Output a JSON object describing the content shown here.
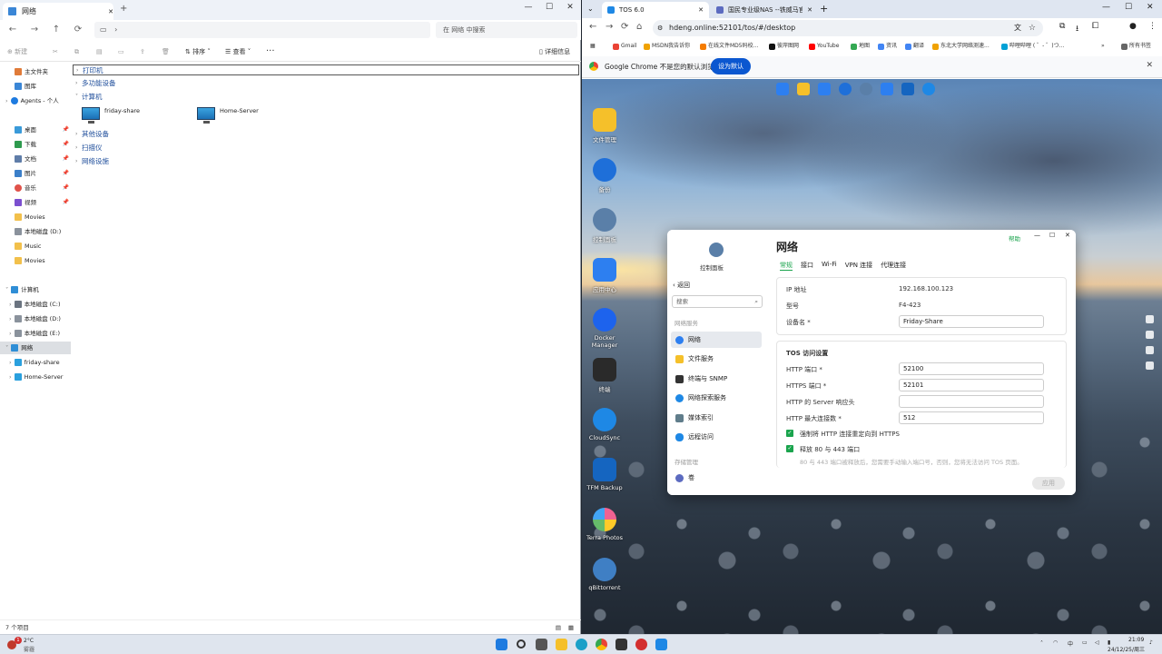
{
  "explorer": {
    "tab_title": "网络",
    "new_tab": "+",
    "window_controls": {
      "minimize": "—",
      "maximize": "☐",
      "close": "✕"
    },
    "address": "›",
    "search_placeholder": "在 网络 中搜索",
    "commands": {
      "new": "新建",
      "sort": "排序",
      "view": "查看",
      "more": "···",
      "details": "详细信息"
    },
    "nav": [
      {
        "label": "主文件夹"
      },
      {
        "label": "图库"
      },
      {
        "label": "Agents - 个人"
      },
      {
        "label": "桌面"
      },
      {
        "label": "下载"
      },
      {
        "label": "文档"
      },
      {
        "label": "图片"
      },
      {
        "label": "音乐"
      },
      {
        "label": "视频"
      },
      {
        "label": "Movies"
      },
      {
        "label": "本地磁盘 (D:)"
      },
      {
        "label": "Music"
      },
      {
        "label": "Movies"
      },
      {
        "label": "计算机"
      },
      {
        "label": "本地磁盘 (C:)"
      },
      {
        "label": "本地磁盘 (D:)"
      },
      {
        "label": "本地磁盘 (E:)"
      },
      {
        "label": "网络"
      },
      {
        "label": "friday-share"
      },
      {
        "label": "Home-Server"
      }
    ],
    "groups": {
      "printers": "打印机",
      "multifunction": "多功能设备",
      "computers": "计算机",
      "other": "其他设备",
      "scanners": "扫描仪",
      "infrastructure": "网络设施"
    },
    "computers": [
      {
        "name": "friday-share"
      },
      {
        "name": "Home-Server"
      }
    ],
    "status": "7 个项目"
  },
  "chrome": {
    "tabs": [
      {
        "title": "TOS 6.0",
        "close": "✕"
      },
      {
        "title": "国民专业级NAS --铁威马官方...",
        "close": "✕"
      }
    ],
    "new_tab": "+",
    "url": "hdeng.online:52101/tos/#/desktop",
    "bookmarks": [
      "Gmail",
      "MSDN我告诉你",
      "在线文件MD5码校...",
      "彼岸图网",
      "YouTube",
      "地图",
      "资讯",
      "翻译",
      "东北大学网络测速...",
      "哔哩哔哩 ( ゜- ゜)つ..."
    ],
    "all_bookmarks": "所有书签",
    "infobar": {
      "message": "Google Chrome 不是您的默认浏览器",
      "button": "设为默认"
    }
  },
  "desktop_icons": [
    {
      "label": "文件管理",
      "color": "#f5c02a"
    },
    {
      "label": "备份",
      "color": "#1e6fd9"
    },
    {
      "label": "控制面板",
      "color": "#5a7fa8"
    },
    {
      "label": "应用中心",
      "color": "#2d7ff0"
    },
    {
      "label": "Docker Manager",
      "color": "#1d63ed"
    },
    {
      "label": "终端",
      "color": "#2a2a2a"
    },
    {
      "label": "CloudSync",
      "color": "#1e88e5"
    },
    {
      "label": "TFM Backup",
      "color": "#1565c0"
    },
    {
      "label": "Terra Photos",
      "color": "#f06292"
    },
    {
      "label": "qBittorrent",
      "color": "#3f7fc4"
    }
  ],
  "control_panel": {
    "app_title": "控制面板",
    "help": "帮助",
    "back": "返回",
    "search_placeholder": "搜索",
    "section_network": "网络服务",
    "section_storage": "存储管理",
    "side": [
      {
        "label": "网络",
        "color": "#2d7ff0"
      },
      {
        "label": "文件服务",
        "color": "#f5c02a"
      },
      {
        "label": "终端与 SNMP",
        "color": "#333"
      },
      {
        "label": "网络探索服务",
        "color": "#1e88e5"
      },
      {
        "label": "媒体索引",
        "color": "#607d8b"
      },
      {
        "label": "远程访问",
        "color": "#1e88e5"
      },
      {
        "label": "卷",
        "color": "#5c6bc0"
      }
    ],
    "title": "网络",
    "tabs": [
      "常规",
      "接口",
      "Wi-Fi",
      "VPN 连接",
      "代理连接"
    ],
    "general": {
      "ip_label": "IP 地址",
      "ip_value": "192.168.100.123",
      "model_label": "型号",
      "model_value": "F4-423",
      "device_label": "设备名 *",
      "device_value": "Friday-Share"
    },
    "tos_access": {
      "heading": "TOS 访问设置",
      "http_port_label": "HTTP 端口 *",
      "http_port": "52100",
      "https_port_label": "HTTPS 端口 *",
      "https_port": "52101",
      "server_header_label": "HTTP 的 Server 响应头",
      "server_header": "",
      "max_conn_label": "HTTP 最大连接数 *",
      "max_conn": "512",
      "redirect_label": "强制将 HTTP 连接重定向到 HTTPS",
      "release_label": "释放 80 与 443 端口",
      "release_hint": "80 与 443 端口被释放后，您需要手动输入端口号，否则，您将无法访问 TOS 页面。"
    },
    "apply": "应用"
  },
  "taskbar": {
    "weather_temp": "2°C",
    "weather_text": "雾霾",
    "notification_count": "1",
    "time": "21:09",
    "date": "24/12/25/周三"
  }
}
